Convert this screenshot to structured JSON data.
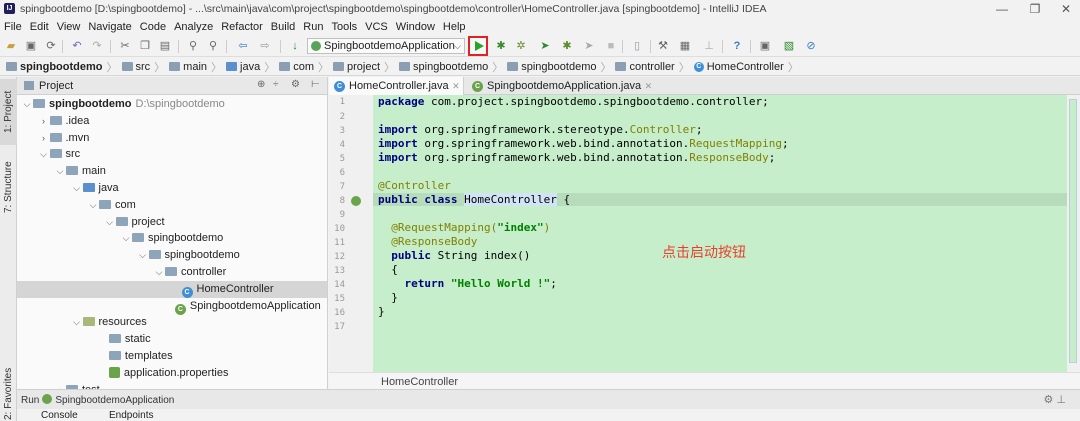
{
  "window": {
    "title": "spingbootdemo [D:\\spingbootdemo] - ...\\src\\main\\java\\com\\project\\spingbootdemo\\spingbootdemo\\controller\\HomeController.java [spingbootdemo] - IntelliJ IDEA",
    "minimize": "—",
    "restore": "❐",
    "close": "✕"
  },
  "menu": [
    "File",
    "Edit",
    "View",
    "Navigate",
    "Code",
    "Analyze",
    "Refactor",
    "Build",
    "Run",
    "Tools",
    "VCS",
    "Window",
    "Help"
  ],
  "toolbar": {
    "run_config": "SpingbootdemoApplication",
    "icons": [
      "open-icon",
      "save-icon",
      "sync-icon",
      "back-icon",
      "forward-icon",
      "cut-icon",
      "copy-icon",
      "paste-icon",
      "find-icon",
      "replace-icon",
      "navigate-back-icon",
      "navigate-forward-icon",
      "build-icon"
    ],
    "run_highlight_color": "#e02222"
  },
  "navbar": {
    "crumbs": [
      "spingbootdemo",
      "src",
      "main",
      "java",
      "com",
      "project",
      "spingbootdemo",
      "spingbootdemo",
      "controller",
      "HomeController"
    ]
  },
  "side_tabs": {
    "project": "1: Project",
    "structure": "7: Structure",
    "favorites": "2: Favorites"
  },
  "project_panel": {
    "title": "Project",
    "tree": [
      {
        "label": "spingbootdemo",
        "extra": "D:\\spingbootdemo",
        "indent": 0,
        "icon": "folder",
        "open": true
      },
      {
        "label": ".idea",
        "indent": 1,
        "icon": "folder",
        "open": false
      },
      {
        "label": ".mvn",
        "indent": 1,
        "icon": "folder",
        "open": false
      },
      {
        "label": "src",
        "indent": 1,
        "icon": "folder",
        "open": true
      },
      {
        "label": "main",
        "indent": 2,
        "icon": "folder",
        "open": true
      },
      {
        "label": "java",
        "indent": 3,
        "icon": "src",
        "open": true
      },
      {
        "label": "com",
        "indent": 4,
        "icon": "folder",
        "open": true
      },
      {
        "label": "project",
        "indent": 5,
        "icon": "folder",
        "open": true
      },
      {
        "label": "spingbootdemo",
        "indent": 6,
        "icon": "folder",
        "open": true
      },
      {
        "label": "spingbootdemo",
        "indent": 7,
        "icon": "folder",
        "open": true
      },
      {
        "label": "controller",
        "indent": 8,
        "icon": "folder",
        "open": true
      },
      {
        "label": "HomeController",
        "indent": 9,
        "icon": "class",
        "selected": true
      },
      {
        "label": "SpingbootdemoApplication",
        "indent": 8.6,
        "icon": "spring"
      },
      {
        "label": "resources",
        "indent": 3,
        "icon": "res",
        "open": true
      },
      {
        "label": "static",
        "indent": 4.6,
        "icon": "folder"
      },
      {
        "label": "templates",
        "indent": 4.6,
        "icon": "folder"
      },
      {
        "label": "application.properties",
        "indent": 4.6,
        "icon": "prop"
      },
      {
        "label": "test",
        "indent": 2,
        "icon": "folder",
        "open": false
      }
    ]
  },
  "editor": {
    "tabs": [
      {
        "label": "HomeController.java",
        "active": true
      },
      {
        "label": "SpingbootdemoApplication.java",
        "active": false
      }
    ],
    "line_numbers": [
      "1",
      "2",
      "3",
      "4",
      "5",
      "6",
      "7",
      "8",
      "9",
      "10",
      "11",
      "12",
      "13",
      "14",
      "15",
      "16",
      "17"
    ],
    "code": {
      "l1_kw": "package",
      "l1_rest": " com.project.spingbootdemo.spingbootdemo.controller;",
      "l3_kw": "import",
      "l3_a": " org.springframework.stereotype.",
      "l3_b": "Controller",
      "l3_c": ";",
      "l4_kw": "import",
      "l4_a": " org.springframework.web.bind.annotation.",
      "l4_b": "RequestMapping",
      "l4_c": ";",
      "l5_kw": "import",
      "l5_a": " org.springframework.web.bind.annotation.",
      "l5_b": "ResponseBody",
      "l5_c": ";",
      "l7_a": "@",
      "l7_b": "Controller",
      "l8_kw1": "public",
      "l8_kw2": "class",
      "l8_name": "HomeController",
      "l8_rest": " {",
      "l10_an": "@RequestMapping(",
      "l10_str": "\"index\"",
      "l10_an2": ")",
      "l11_an": "@ResponseBody",
      "l12_kw": "public",
      "l12_rest": " String index()",
      "l13": "{",
      "l14_kw": "return",
      "l14_str": "\"Hello World !\"",
      "l14_rest": ";",
      "l15": "}",
      "l16": "}"
    },
    "annotation_text": "点击启动按钮",
    "breadcrumb_bottom": "HomeController",
    "bg_color": "#c7eecb"
  },
  "run_panel": {
    "label_prefix": "Run",
    "config": "SpingbootdemoApplication",
    "tabs": [
      "Console",
      "Endpoints"
    ]
  }
}
